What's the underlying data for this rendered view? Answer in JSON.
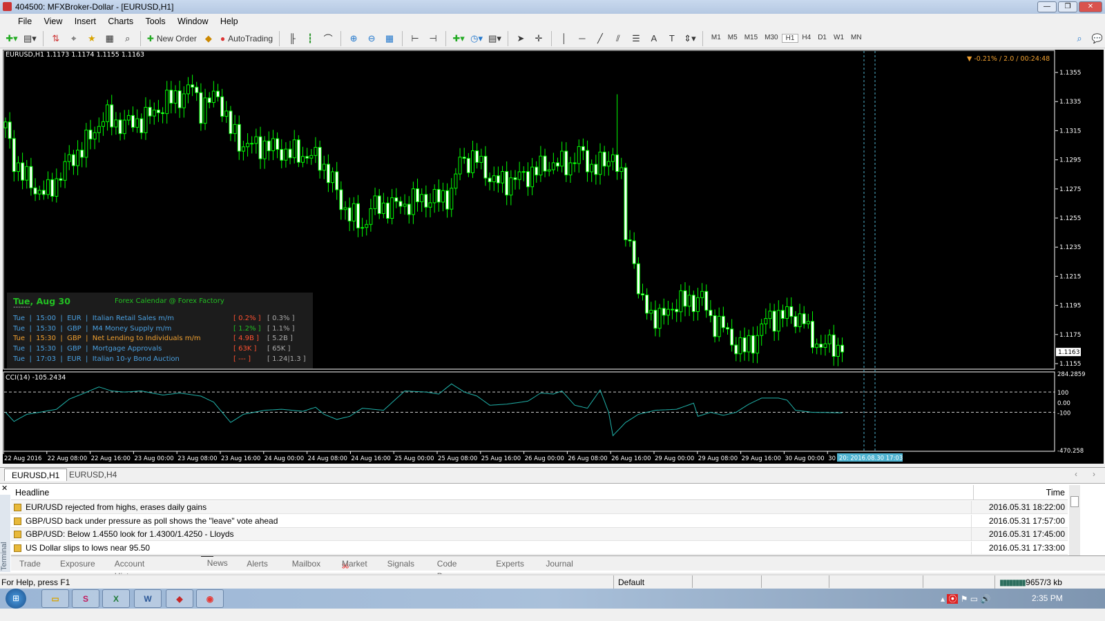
{
  "window": {
    "title": "404500: MFXBroker-Dollar - [EURUSD,H1]",
    "min": "—",
    "max": "❐",
    "close": "✕"
  },
  "menu": [
    "File",
    "View",
    "Insert",
    "Charts",
    "Tools",
    "Window",
    "Help"
  ],
  "toolbar": {
    "new_order": "New Order",
    "autotrading": "AutoTrading",
    "timeframes": [
      "M1",
      "M5",
      "M15",
      "M30",
      "H1",
      "H4",
      "D1",
      "W1",
      "MN"
    ],
    "active_timeframe": "H1"
  },
  "chart": {
    "header": "EURUSD,H1  1.1173 1.1174 1.1155 1.1163",
    "info": "▼ -0.21% / 2.0 / 00:24:48",
    "price_ticks": [
      "1.1355",
      "1.1335",
      "1.1315",
      "1.1295",
      "1.1275",
      "1.1255",
      "1.1235",
      "1.1215",
      "1.1195",
      "1.1175",
      "1.1155"
    ],
    "current_price": "1.1163",
    "price_range": [
      1.1355,
      1.1155
    ],
    "price_path": [
      [
        0,
        1.1317
      ],
      [
        2,
        1.1295
      ],
      [
        4,
        1.1285
      ],
      [
        7,
        1.1275
      ],
      [
        10,
        1.1272
      ],
      [
        14,
        1.129
      ],
      [
        17,
        1.13
      ],
      [
        20,
        1.131
      ],
      [
        23,
        1.1325
      ],
      [
        26,
        1.132
      ],
      [
        30,
        1.132
      ],
      [
        34,
        1.1325
      ],
      [
        38,
        1.1335
      ],
      [
        42,
        1.134
      ],
      [
        44,
        1.1345
      ],
      [
        46,
        1.133
      ],
      [
        50,
        1.134
      ],
      [
        53,
        1.1315
      ],
      [
        56,
        1.1305
      ],
      [
        61,
        1.1305
      ],
      [
        66,
        1.13
      ],
      [
        71,
        1.1298
      ],
      [
        74,
        1.1295
      ],
      [
        77,
        1.128
      ],
      [
        79,
        1.1265
      ],
      [
        82,
        1.1255
      ],
      [
        84,
        1.1248
      ],
      [
        86,
        1.1262
      ],
      [
        90,
        1.1263
      ],
      [
        95,
        1.1265
      ],
      [
        97,
        1.1268
      ],
      [
        102,
        1.1268
      ],
      [
        105,
        1.1272
      ],
      [
        107,
        1.1295
      ],
      [
        111,
        1.1295
      ],
      [
        115,
        1.128
      ],
      [
        118,
        1.128
      ],
      [
        123,
        1.1285
      ],
      [
        128,
        1.1292
      ],
      [
        133,
        1.1292
      ],
      [
        135,
        1.13
      ],
      [
        138,
        1.129
      ],
      [
        141,
        1.1292
      ],
      [
        143,
        1.13
      ],
      [
        145,
        1.128
      ],
      [
        146,
        1.1245
      ],
      [
        148,
        1.123
      ],
      [
        149,
        1.12
      ],
      [
        152,
        1.119
      ],
      [
        154,
        1.1185
      ],
      [
        157,
        1.1195
      ],
      [
        161,
        1.1198
      ],
      [
        164,
        1.12
      ],
      [
        166,
        1.1185
      ],
      [
        169,
        1.118
      ],
      [
        171,
        1.117
      ],
      [
        174,
        1.1165
      ],
      [
        176,
        1.117
      ],
      [
        179,
        1.1185
      ],
      [
        182,
        1.1188
      ],
      [
        185,
        1.1188
      ],
      [
        188,
        1.1185
      ],
      [
        189,
        1.1175
      ],
      [
        192,
        1.1167
      ],
      [
        195,
        1.1168
      ],
      [
        197,
        1.1163
      ]
    ],
    "spike_high": {
      "bar": 144,
      "price": 1.134
    },
    "cci": {
      "label": "CCI(14) -105.2434",
      "ticks": [
        "284.2859",
        "100",
        "0.00",
        "-100",
        "-470.258"
      ],
      "range": [
        284.2859,
        -470.258
      ],
      "path": [
        [
          0,
          -100
        ],
        [
          2,
          -190
        ],
        [
          5,
          -120
        ],
        [
          8,
          -100
        ],
        [
          12,
          -70
        ],
        [
          15,
          30
        ],
        [
          18,
          80
        ],
        [
          22,
          150
        ],
        [
          25,
          110
        ],
        [
          28,
          100
        ],
        [
          32,
          110
        ],
        [
          37,
          70
        ],
        [
          41,
          90
        ],
        [
          46,
          60
        ],
        [
          49,
          0
        ],
        [
          51,
          -100
        ],
        [
          53,
          -200
        ],
        [
          56,
          -120
        ],
        [
          61,
          -80
        ],
        [
          65,
          -70
        ],
        [
          70,
          -90
        ],
        [
          73,
          -50
        ],
        [
          75,
          -120
        ],
        [
          78,
          -170
        ],
        [
          81,
          -140
        ],
        [
          84,
          -60
        ],
        [
          89,
          -80
        ],
        [
          94,
          110
        ],
        [
          99,
          100
        ],
        [
          102,
          80
        ],
        [
          105,
          180
        ],
        [
          108,
          100
        ],
        [
          111,
          60
        ],
        [
          114,
          -30
        ],
        [
          118,
          -20
        ],
        [
          123,
          10
        ],
        [
          126,
          90
        ],
        [
          129,
          80
        ],
        [
          131,
          110
        ],
        [
          134,
          -30
        ],
        [
          137,
          -60
        ],
        [
          140,
          120
        ],
        [
          142,
          -100
        ],
        [
          143,
          -330
        ],
        [
          146,
          -200
        ],
        [
          149,
          -120
        ],
        [
          153,
          -80
        ],
        [
          158,
          -70
        ],
        [
          162,
          -10
        ],
        [
          163,
          -140
        ],
        [
          166,
          -100
        ],
        [
          169,
          -130
        ],
        [
          172,
          -100
        ],
        [
          175,
          -20
        ],
        [
          178,
          40
        ],
        [
          182,
          40
        ],
        [
          184,
          20
        ],
        [
          186,
          -80
        ],
        [
          190,
          -100
        ],
        [
          197,
          -105
        ]
      ]
    },
    "time_labels": [
      "22 Aug 2016",
      "22 Aug 08:00",
      "22 Aug 16:00",
      "23 Aug 00:00",
      "23 Aug 08:00",
      "23 Aug 16:00",
      "24 Aug 00:00",
      "24 Aug 08:00",
      "24 Aug 16:00",
      "25 Aug 00:00",
      "25 Aug 08:00",
      "25 Aug 16:00",
      "26 Aug 00:00",
      "26 Aug 08:00",
      "26 Aug 16:00",
      "29 Aug 00:00",
      "29 Aug 08:00",
      "29 Aug 16:00",
      "30 Aug 00:00",
      "30 A"
    ],
    "crosshair_label": "20: 2016.08.30 17:03",
    "colors": {
      "bull": "#00ff00",
      "bear": "#00ff00",
      "cci": "#20b2aa",
      "crosshair": "#4fb3d0"
    }
  },
  "calendar": {
    "date": "Tue, Aug 30",
    "source": "Forex Calendar @ Forex Factory",
    "divider": "-------",
    "events": [
      {
        "text": "Tue  |  15:00  |  EUR  |  Italian Retail Sales m/m",
        "actual": "[ 0.2% ]",
        "forecast": "[ 0.3% ]",
        "color": "#4aa0e0",
        "actual_color": "#ff5030"
      },
      {
        "text": "Tue  |  15:30  |  GBP  |  M4 Money Supply m/m",
        "actual": "[ 1.2% ]",
        "forecast": "[ 1.1% ]",
        "color": "#4aa0e0",
        "actual_color": "#22c022"
      },
      {
        "text": "Tue  |  15:30  |  GBP  |  Net Lending to Individuals m/m",
        "actual": "[ 4.9B ]",
        "forecast": "[ 5.2B ]",
        "color": "#f0a030",
        "actual_color": "#ff5030"
      },
      {
        "text": "Tue  |  15:30  |  GBP  |  Mortgage Approvals",
        "actual": "[ 63K ]",
        "forecast": "[ 65K ]",
        "color": "#4aa0e0",
        "actual_color": "#ff5030"
      },
      {
        "text": "Tue  |  17:03  |  EUR  |  Italian 10-y Bond Auction",
        "actual": "[ --- ]",
        "forecast": "[ 1.24|1.3 ]",
        "color": "#4aa0e0",
        "actual_color": "#ff5030"
      }
    ]
  },
  "chart_tabs": [
    "EURUSD,H1",
    "EURUSD,H4"
  ],
  "terminal": {
    "side_label": "Terminal",
    "headline_col": "Headline",
    "time_col": "Time",
    "news": [
      {
        "headline": "EUR/USD rejected from highs, erases daily gains",
        "time": "2016.05.31 18:22:00"
      },
      {
        "headline": "GBP/USD back under pressure as poll shows the \"leave\" vote ahead",
        "time": "2016.05.31 17:57:00"
      },
      {
        "headline": "GBP/USD: Below 1.4550 look for 1.4300/1.4250 - Lloyds",
        "time": "2016.05.31 17:45:00"
      },
      {
        "headline": "US Dollar slips to lows near 95.50",
        "time": "2016.05.31 17:33:00"
      }
    ],
    "tabs": [
      "Trade",
      "Exposure",
      "Account History",
      "News",
      "Alerts",
      "Mailbox",
      "Market",
      "Signals",
      "Code Base",
      "Experts",
      "Journal"
    ],
    "active_tab": "News",
    "market_badge": "36"
  },
  "status": {
    "help": "For Help, press F1",
    "profile": "Default",
    "traffic": "9657/3 kb"
  },
  "taskbar": {
    "clock": "2:35 PM",
    "apps": [
      "Explorer",
      "App",
      "Excel",
      "Word",
      "MetaTrader",
      "Chrome"
    ]
  }
}
